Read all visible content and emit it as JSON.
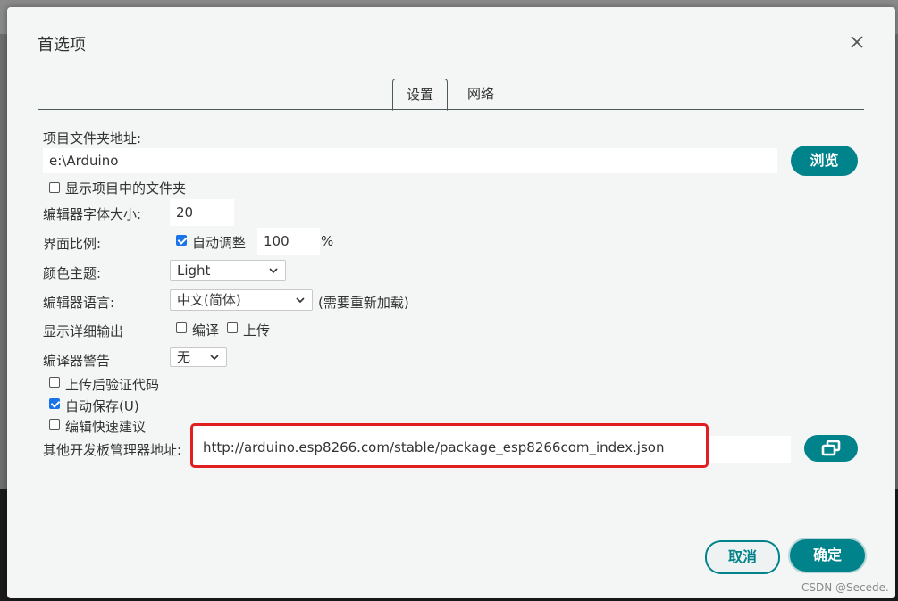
{
  "dialog": {
    "title": "首选项"
  },
  "tabs": [
    {
      "label": "设置"
    },
    {
      "label": "网络"
    }
  ],
  "settings": {
    "sketchbook_label": "项目文件夹地址:",
    "sketchbook_value": "e:\\Arduino",
    "browse_label": "浏览",
    "show_files_label": "显示项目中的文件夹",
    "show_files_checked": false,
    "font_size_label": "编辑器字体大小:",
    "font_size_value": "20",
    "scale_label": "界面比例:",
    "auto_scale_label": "自动调整",
    "auto_scale_checked": true,
    "scale_value": "100",
    "scale_unit": "%",
    "theme_label": "颜色主题:",
    "theme_value": "Light",
    "language_label": "编辑器语言:",
    "language_value": "中文(简体)",
    "language_note": "(需要重新加载)",
    "verbose_label": "显示详细输出",
    "verbose_compile_label": "编译",
    "verbose_compile_checked": false,
    "verbose_upload_label": "上传",
    "verbose_upload_checked": false,
    "warnings_label": "编译器警告",
    "warnings_value": "无",
    "verify_label": "上传后验证代码",
    "verify_checked": false,
    "autosave_label": "自动保存(U)",
    "autosave_checked": true,
    "quick_suggest_label": "编辑快速建议",
    "quick_suggest_checked": false,
    "board_urls_label": "其他开发板管理器地址:",
    "board_urls_value": "http://arduino.esp8266.com/stable/package_esp8266com_index.json"
  },
  "footer": {
    "cancel_label": "取消",
    "ok_label": "确定"
  },
  "watermark": "CSDN @Secede.",
  "colors": {
    "accent": "#00838a",
    "highlight": "#e02020",
    "checkbox": "#1a73e8"
  }
}
